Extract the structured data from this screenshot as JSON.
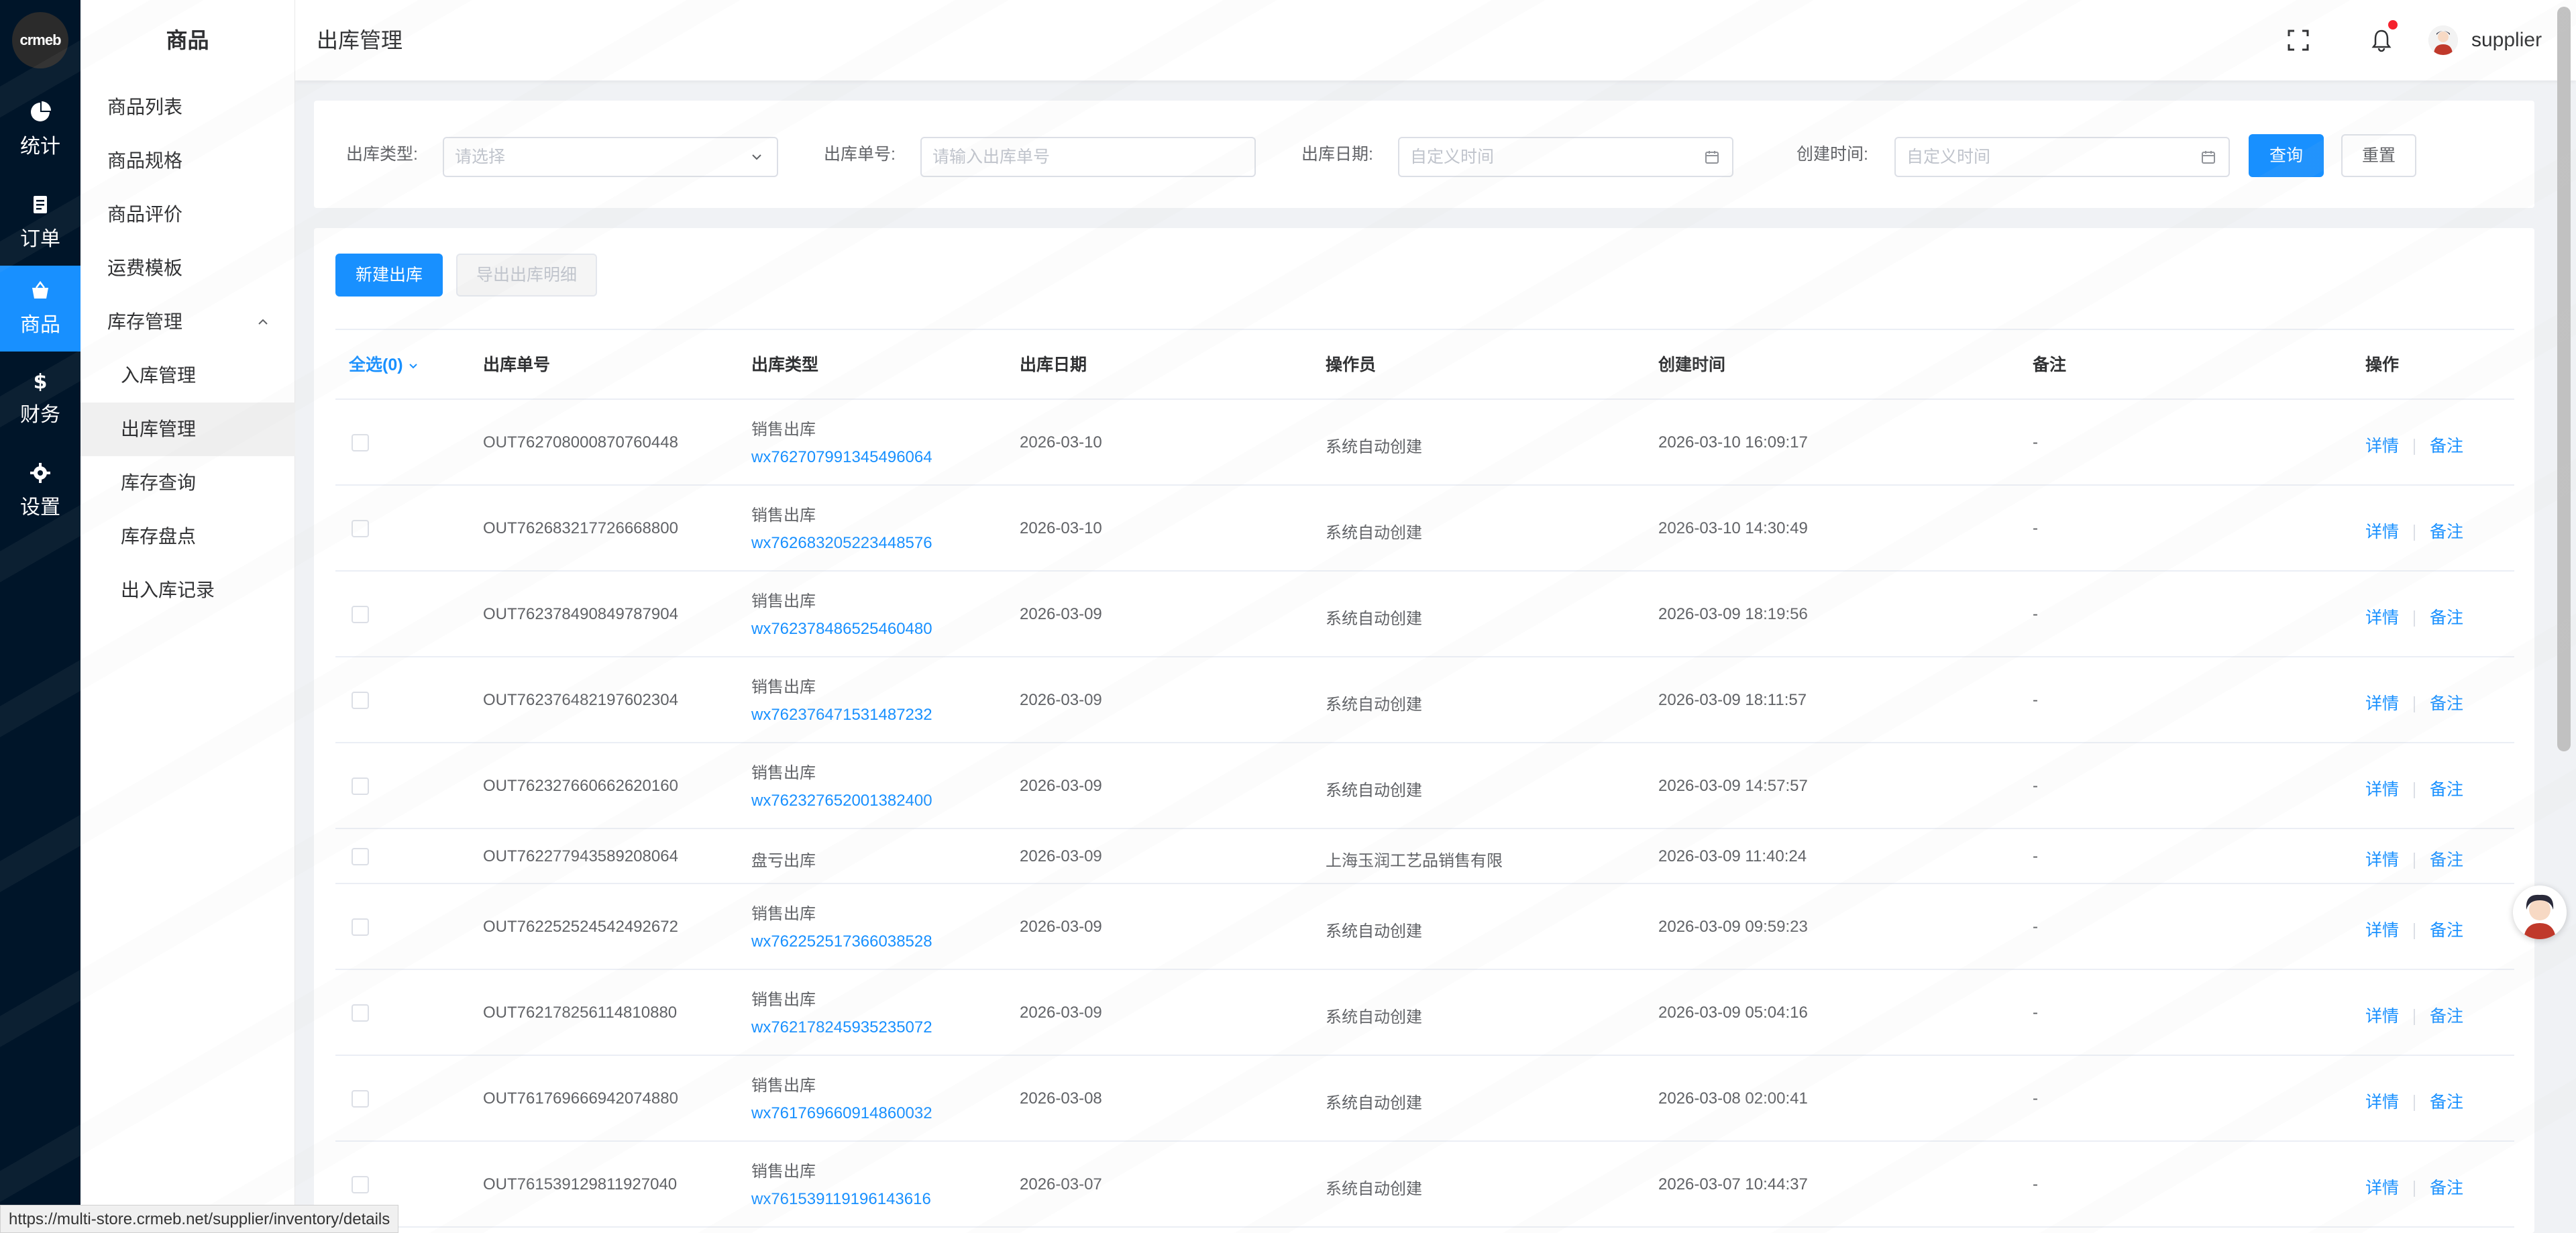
{
  "rail": {
    "logo_text": "crmeb",
    "items": [
      {
        "label": "统计",
        "icon": "pie-chart-icon"
      },
      {
        "label": "订单",
        "icon": "document-icon"
      },
      {
        "label": "商品",
        "icon": "shopping-bag-icon",
        "active": true
      },
      {
        "label": "财务",
        "icon": "dollar-icon"
      },
      {
        "label": "设置",
        "icon": "gear-icon"
      }
    ]
  },
  "submenu": {
    "title": "商品",
    "items": [
      {
        "label": "商品列表"
      },
      {
        "label": "商品规格"
      },
      {
        "label": "商品评价"
      },
      {
        "label": "运费模板"
      },
      {
        "label": "库存管理",
        "expanded": true
      },
      {
        "label": "入库管理"
      },
      {
        "label": "出库管理",
        "active": true
      },
      {
        "label": "库存查询"
      },
      {
        "label": "库存盘点"
      },
      {
        "label": "出入库记录"
      }
    ]
  },
  "header": {
    "breadcrumb": "出库管理",
    "username": "supplier"
  },
  "filter": {
    "type_label": "出库类型:",
    "type_placeholder": "请选择",
    "no_label": "出库单号:",
    "no_placeholder": "请输入出库单号",
    "date_label": "出库日期:",
    "date_placeholder": "自定义时间",
    "created_label": "创建时间:",
    "created_placeholder": "自定义时间",
    "query_btn": "查询",
    "reset_btn": "重置"
  },
  "toolbar": {
    "new_btn": "新建出库",
    "export_btn": "导出出库明细"
  },
  "table": {
    "select_all": "全选(0)",
    "headers": {
      "no": "出库单号",
      "type": "出库类型",
      "date": "出库日期",
      "operator": "操作员",
      "created": "创建时间",
      "remark": "备注",
      "ops": "操作"
    },
    "op_detail": "详情",
    "op_remark": "备注",
    "rows": [
      {
        "no": "OUT762708000870760448",
        "type": "销售出库",
        "order": "wx762707991345496064",
        "date": "2026-03-10",
        "operator": "系统自动创建",
        "created": "2026-03-10 16:09:17",
        "remark": "-"
      },
      {
        "no": "OUT762683217726668800",
        "type": "销售出库",
        "order": "wx762683205223448576",
        "date": "2026-03-10",
        "operator": "系统自动创建",
        "created": "2026-03-10 14:30:49",
        "remark": "-"
      },
      {
        "no": "OUT762378490849787904",
        "type": "销售出库",
        "order": "wx762378486525460480",
        "date": "2026-03-09",
        "operator": "系统自动创建",
        "created": "2026-03-09 18:19:56",
        "remark": "-"
      },
      {
        "no": "OUT762376482197602304",
        "type": "销售出库",
        "order": "wx762376471531487232",
        "date": "2026-03-09",
        "operator": "系统自动创建",
        "created": "2026-03-09 18:11:57",
        "remark": "-"
      },
      {
        "no": "OUT762327660662620160",
        "type": "销售出库",
        "order": "wx762327652001382400",
        "date": "2026-03-09",
        "operator": "系统自动创建",
        "created": "2026-03-09 14:57:57",
        "remark": "-"
      },
      {
        "no": "OUT762277943589208064",
        "type": "盘亏出库",
        "order": "",
        "date": "2026-03-09",
        "operator": "上海玉润工艺品销售有限",
        "created": "2026-03-09 11:40:24",
        "remark": "-"
      },
      {
        "no": "OUT762252524542492672",
        "type": "销售出库",
        "order": "wx762252517366038528",
        "date": "2026-03-09",
        "operator": "系统自动创建",
        "created": "2026-03-09 09:59:23",
        "remark": "-"
      },
      {
        "no": "OUT762178256114810880",
        "type": "销售出库",
        "order": "wx762178245935235072",
        "date": "2026-03-09",
        "operator": "系统自动创建",
        "created": "2026-03-09 05:04:16",
        "remark": "-"
      },
      {
        "no": "OUT761769666942074880",
        "type": "销售出库",
        "order": "wx761769660914860032",
        "date": "2026-03-08",
        "operator": "系统自动创建",
        "created": "2026-03-08 02:00:41",
        "remark": "-"
      },
      {
        "no": "OUT761539129811927040",
        "type": "销售出库",
        "order": "wx761539119196143616",
        "date": "2026-03-07",
        "operator": "系统自动创建",
        "created": "2026-03-07 10:44:37",
        "remark": "-"
      }
    ]
  },
  "status_url": "https://multi-store.crmeb.net/supplier/inventory/details",
  "colors": {
    "primary": "#1890ff",
    "rail_bg": "#001529"
  }
}
